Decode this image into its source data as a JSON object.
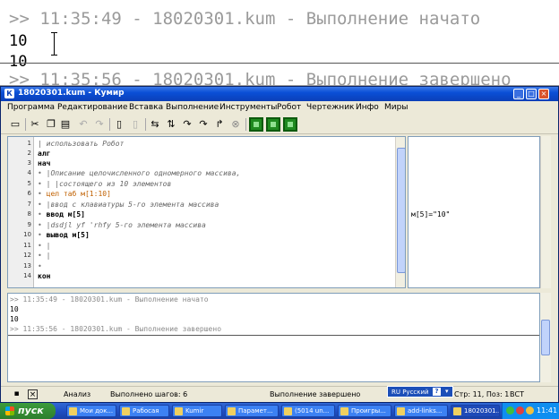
{
  "background_output": {
    "lines": [
      ">> 11:35:49 - 18020301.kum - Выполнение начато",
      "10",
      "10",
      ">> 11:35:56 - 18020301.kum - Выполнение завершено"
    ]
  },
  "window": {
    "title": "18020301.kum - Кумир",
    "icon_label": "К",
    "minimize": "_",
    "maximize": "□",
    "close": "×"
  },
  "menu": [
    "Программа",
    "Редактирование",
    "Вставка",
    "Выполнение",
    "Инструменты",
    "Робот",
    "Чертежник",
    "Инфо",
    "Миры"
  ],
  "toolbar_icons": [
    "save-icon",
    "cut-icon",
    "copy-icon",
    "paste-icon",
    "undo-icon",
    "redo-icon",
    "doc-icon",
    "doc2-icon",
    "step-icon",
    "step-over-icon",
    "step-in-icon",
    "step-out-icon",
    "run-to-icon",
    "stop-icon",
    "grid-icon",
    "robot-icon",
    "drawer-icon"
  ],
  "editor": {
    "line_numbers": [
      "1",
      "2",
      "3",
      "4",
      "5",
      "6",
      "7",
      "8",
      "9",
      "10",
      "11",
      "12",
      "13",
      "14"
    ],
    "lines": [
      "| использовать Робот",
      "алг",
      "нач",
      "|Описание целочисленного одномерного массива,",
      "| |состоящего из 10 элементов",
      "цел таб м[1:10]",
      "|ввод с клавиатуры 5-го элемента массива",
      "ввод м[5]",
      "|dsdjl yf 'rhfy 5-го элемента массива",
      "вывод м[5]",
      "|",
      "|",
      "",
      "кон"
    ]
  },
  "margin": {
    "value": "м[5]=\"10\""
  },
  "output": {
    "lines": [
      ">> 11:35:49 - 18020301.kum - Выполнение начато",
      "10",
      "10",
      ">> 11:35:56 - 18020301.kum - Выполнение завершено"
    ]
  },
  "status": {
    "mode": "Анализ",
    "steps": "Выполнено шагов: 6",
    "state": "Выполнение завершено",
    "position": "Стр: 11, Поз: 1",
    "insert_mode": "ВСТ"
  },
  "langbar": {
    "label": "RU Русский",
    "help": "?"
  },
  "taskbar": {
    "start": "пуск",
    "tasks": [
      "Мои док...",
      "Рабосая",
      "Kumir",
      "Парамет...",
      "(5014 un...",
      "Проигры...",
      "add-links...",
      "18020301...."
    ],
    "clock": "11:41"
  },
  "colors": {
    "title_bar": "#0a4fd6",
    "taskbar": "#1f4fc4",
    "start_button": "#2d7f2d",
    "keyword_type": "#c06000",
    "number": "#0070a0",
    "comment": "#666666"
  }
}
